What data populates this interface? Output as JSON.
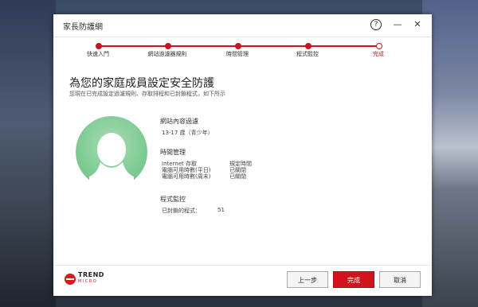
{
  "window": {
    "title": "家長防護網"
  },
  "titlebar_icons": {
    "help": "?",
    "minimize": "—",
    "close": "✕"
  },
  "stepper": {
    "steps": [
      {
        "label": "快速入門",
        "state": "done"
      },
      {
        "label": "網站過濾器規則",
        "state": "done"
      },
      {
        "label": "時間管理",
        "state": "done"
      },
      {
        "label": "程式監控",
        "state": "done"
      },
      {
        "label": "完成",
        "state": "current"
      }
    ],
    "accent_color": "#c8141e"
  },
  "main": {
    "title": "為您的家庭成員設定安全防護",
    "subtitle": "您現在已完成設定過濾規則、存取排程和已封鎖程式，如下所示"
  },
  "summary": {
    "web_filter": {
      "heading": "網站內容過濾",
      "value": "13-17 歲（青少年）"
    },
    "time_management": {
      "heading": "時間管理",
      "rows": [
        {
          "label": "Internet 存取",
          "value": "規定時間"
        },
        {
          "label": "電腦可用時數(平日)",
          "value": "已關閉"
        },
        {
          "label": "電腦可用時數(周末)",
          "value": "已關閉"
        }
      ]
    },
    "program_control": {
      "heading": "程式監控",
      "label": "已封鎖的程式：",
      "value": "51"
    }
  },
  "logo": {
    "line1": "TREND",
    "line2": "MICRO"
  },
  "buttons": {
    "back": "上一步",
    "finish": "完成",
    "cancel": "取消"
  },
  "avatar": {
    "icon": "user-avatar-icon",
    "color": "#7fcb94"
  }
}
